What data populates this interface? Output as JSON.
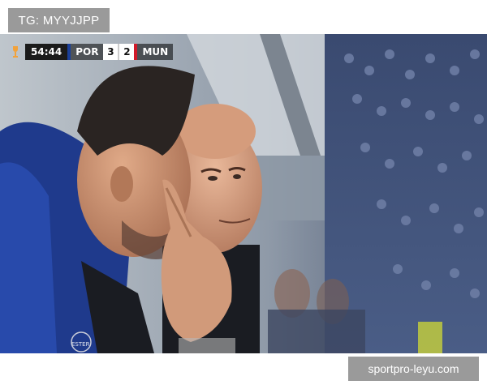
{
  "tag": "TG: MYYJJPP",
  "scoreboard": {
    "clock": "54:44",
    "home_team": "POR",
    "home_score": "3",
    "away_score": "2",
    "away_team": "MUN",
    "competition_icon": "trophy-icon"
  },
  "jacket_text": "ESTER",
  "watermark": "sportpro-leyu.com",
  "colors": {
    "por": "#1a3f9a",
    "mun": "#d11a2a"
  }
}
